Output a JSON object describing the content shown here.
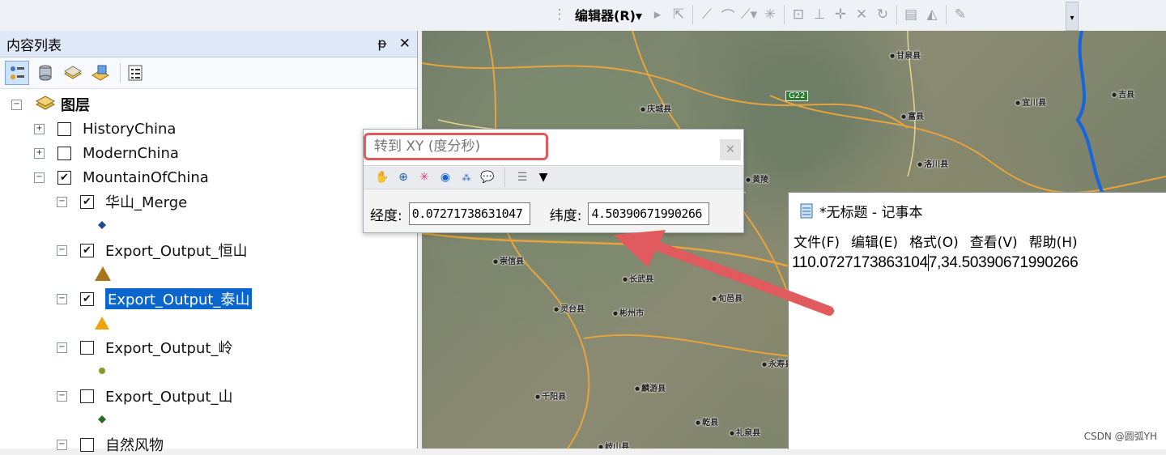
{
  "topbar": {
    "editor_menu": "编辑器(R)▾"
  },
  "toc": {
    "title": "内容列表",
    "pin": "ᵽ",
    "close": "✕",
    "root_label": "图层",
    "layers": [
      {
        "label": "HistoryChina",
        "checked": false,
        "expanded": false
      },
      {
        "label": "ModernChina",
        "checked": false,
        "expanded": false
      },
      {
        "label": "MountainOfChina",
        "checked": true,
        "expanded": true
      },
      {
        "label": "华山_Merge",
        "checked": true,
        "expanded": true
      },
      {
        "label": "Export_Output_恒山",
        "checked": true,
        "expanded": true
      },
      {
        "label": "Export_Output_泰山",
        "checked": true,
        "expanded": true,
        "selected": true
      },
      {
        "label": "Export_Output_岭",
        "checked": false,
        "expanded": true
      },
      {
        "label": "Export_Output_山",
        "checked": false,
        "expanded": true
      },
      {
        "label": "自然风物",
        "checked": false,
        "expanded": true
      }
    ]
  },
  "map": {
    "labels": [
      "甘泉县",
      "庆城县",
      "富县",
      "宜川县",
      "吉县",
      "洛川县",
      "黄陵",
      "崇信县",
      "长武县",
      "灵台县",
      "彬州市",
      "旬邑县",
      "永寿县",
      "千阳县",
      "麟游县",
      "乾县",
      "岐山县",
      "礼泉县"
    ],
    "road_badge": "G22"
  },
  "goto_xy": {
    "title": "转到 XY   (度分秒)",
    "close_icon": "✕",
    "lon_label": "经度:",
    "lon_value": "0.07271738631047",
    "lat_label": "纬度:",
    "lat_value": "4.50390671990266"
  },
  "notepad": {
    "title": "*无标题 - 记事本",
    "menu": [
      "文件(F)",
      "编辑(E)",
      "格式(O)",
      "查看(V)",
      "帮助(H)"
    ],
    "content": "110.0727173863104",
    "content_after_cursor": "7,34.50390671990266"
  },
  "watermark": "CSDN @圆弧YH",
  "colors": {
    "highlight_red": "#e05a5e",
    "selection_blue": "#0a66cc",
    "toc_header": "#dfe8f6"
  }
}
